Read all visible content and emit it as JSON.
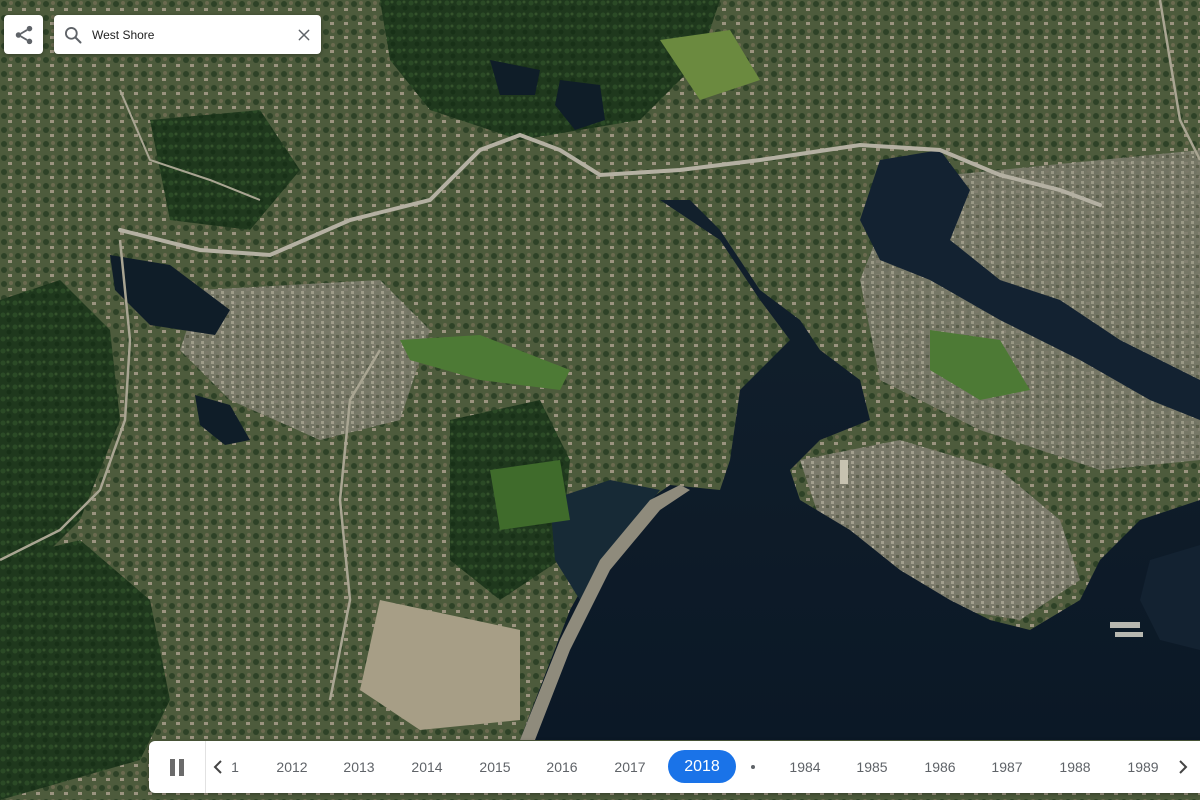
{
  "search": {
    "value": "West Shore"
  },
  "toolbar": {
    "share_icon": "share-icon",
    "search_icon": "search-icon",
    "clear_icon": "close-icon"
  },
  "timeline": {
    "playback_icon": "pause-icon",
    "prev_icon": "chevron-left-icon",
    "next_icon": "chevron-right-icon",
    "partial_label": "1",
    "years_before": [
      "2012",
      "2013",
      "2014",
      "2015",
      "2016",
      "2017"
    ],
    "selected_year": "2018",
    "years_after": [
      "1984",
      "1985",
      "1986",
      "1987",
      "1988",
      "1989"
    ],
    "accent_color": "#1a73e8"
  },
  "map": {
    "water_color": "#0d1a2a",
    "land_color": "#4a5a3c",
    "forest_color": "#1f3a1f",
    "urban_color": "#8a8a7a"
  }
}
